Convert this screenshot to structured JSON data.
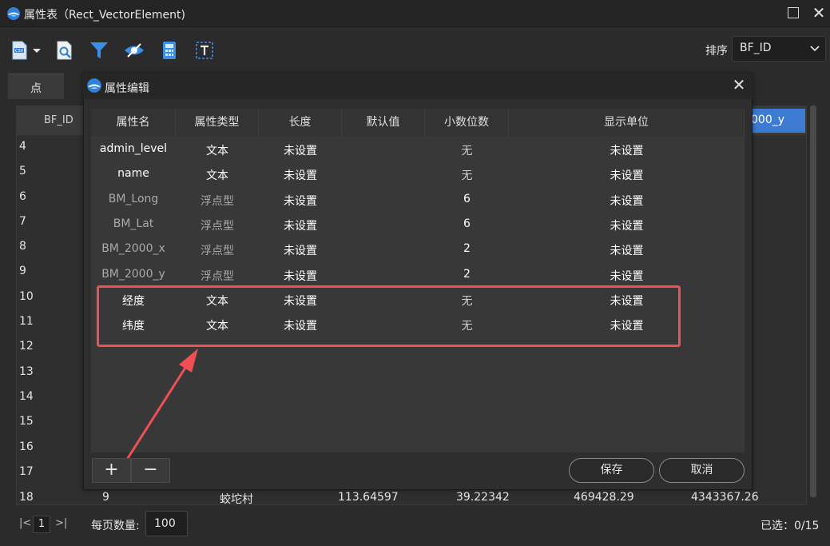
{
  "window": {
    "title": "属性表（Rect_VectorElement)"
  },
  "toolbar": {
    "icons": [
      "export-icon",
      "dropdown-arrow-icon",
      "search-document-icon",
      "filter-icon",
      "visibility-icon",
      "calculator-icon",
      "text-box-icon"
    ],
    "sort_label": "排序",
    "sort_value": "BF_ID"
  },
  "tabs": [
    {
      "label": "点"
    }
  ],
  "background_grid": {
    "first_col_header": "BF_ID",
    "selected_col_header": "000_y",
    "row_numbers": [
      "4",
      "5",
      "6",
      "7",
      "8",
      "9",
      "10",
      "11",
      "12",
      "13",
      "14",
      "15",
      "16",
      "17",
      "18"
    ],
    "row18": {
      "id": "9",
      "name": "蛟坨村",
      "long": "113.64597",
      "lat": "39.22342",
      "x": "469428.29",
      "y": "4343367.26"
    }
  },
  "pager": {
    "first_symbol": "|<",
    "page": "1",
    "last_symbol": ">|",
    "per_page_label": "每页数量:",
    "per_page_value": "100",
    "selected_text": "已选：0/15"
  },
  "dialog": {
    "title": "属性编辑",
    "headers": [
      "属性名",
      "属性类型",
      "长度",
      "默认值",
      "小数位数",
      "显示单位"
    ],
    "rows": [
      {
        "name": "admin_level",
        "type": "文本",
        "length": "未设置",
        "default": "",
        "decimals": "无",
        "unit": "未设置",
        "dim": false
      },
      {
        "name": "name",
        "type": "文本",
        "length": "未设置",
        "default": "",
        "decimals": "无",
        "unit": "未设置",
        "dim": false
      },
      {
        "name": "BM_Long",
        "type": "浮点型",
        "length": "未设置",
        "default": "",
        "decimals": "6",
        "unit": "未设置",
        "dim": true
      },
      {
        "name": "BM_Lat",
        "type": "浮点型",
        "length": "未设置",
        "default": "",
        "decimals": "6",
        "unit": "未设置",
        "dim": true
      },
      {
        "name": "BM_2000_x",
        "type": "浮点型",
        "length": "未设置",
        "default": "",
        "decimals": "2",
        "unit": "未设置",
        "dim": true
      },
      {
        "name": "BM_2000_y",
        "type": "浮点型",
        "length": "未设置",
        "default": "",
        "decimals": "2",
        "unit": "未设置",
        "dim": true
      },
      {
        "name": "经度",
        "type": "文本",
        "length": "未设置",
        "default": "",
        "decimals": "无",
        "unit": "未设置",
        "dim": false
      },
      {
        "name": "纬度",
        "type": "文本",
        "length": "未设置",
        "default": "",
        "decimals": "无",
        "unit": "未设置",
        "dim": false
      }
    ],
    "add_label": "+",
    "remove_label": "−",
    "save_label": "保存",
    "cancel_label": "取消"
  },
  "colors": {
    "accent": "#3c7bd1",
    "highlight": "#f04f55",
    "dim_text": "#a9a9a9"
  }
}
